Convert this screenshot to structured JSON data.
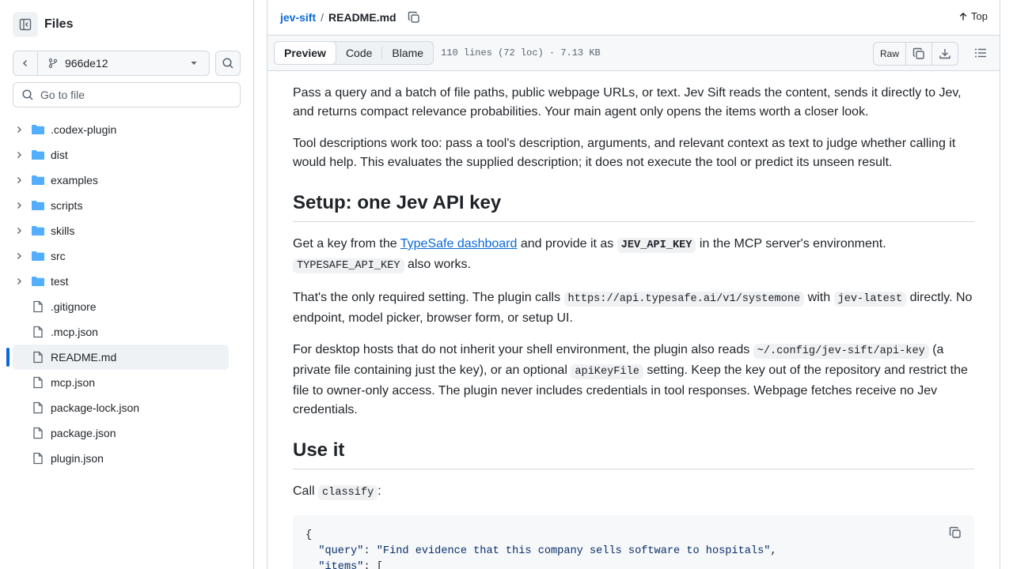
{
  "sidebar": {
    "title": "Files",
    "branch": "966de12",
    "goto_placeholder": "Go to file",
    "folders": [
      ".codex-plugin",
      "dist",
      "examples",
      "scripts",
      "skills",
      "src",
      "test"
    ],
    "files": [
      ".gitignore",
      ".mcp.json",
      "README.md",
      "mcp.json",
      "package-lock.json",
      "package.json",
      "plugin.json"
    ],
    "active_file": "README.md"
  },
  "breadcrumb": {
    "repo": "jev-sift",
    "sep": "/",
    "file": "README.md",
    "top_label": "Top"
  },
  "file_header": {
    "tabs": [
      "Preview",
      "Code",
      "Blame"
    ],
    "meta": "110 lines (72 loc) · 7.13 KB",
    "raw_label": "Raw"
  },
  "content": {
    "p1": "Pass a query and a batch of file paths, public webpage URLs, or text. Jev Sift reads the content, sends it directly to Jev, and returns compact relevance probabilities. Your main agent only opens the items worth a closer look.",
    "p2": "Tool descriptions work too: pass a tool's description, arguments, and relevant context as text to judge whether calling it would help. This evaluates the supplied description; it does not execute the tool or predict its unseen result.",
    "h_setup": "Setup: one Jev API key",
    "p3a": "Get a key from the ",
    "p3_link": "TypeSafe dashboard",
    "p3b": " and provide it as ",
    "p3_code1": "JEV_API_KEY",
    "p3c": " in the MCP server's environment. ",
    "p3_code2": "TYPESAFE_API_KEY",
    "p3d": " also works.",
    "p4a": "That's the only required setting. The plugin calls ",
    "p4_code1": "https://api.typesafe.ai/v1/systemone",
    "p4b": " with ",
    "p4_code2": "jev-latest",
    "p4c": " directly. No endpoint, model picker, browser form, or setup UI.",
    "p5a": "For desktop hosts that do not inherit your shell environment, the plugin also reads ",
    "p5_code1": "~/.config/jev-sift/api-key",
    "p5b": " (a private file containing just the key), or an optional ",
    "p5_code2": "apiKeyFile",
    "p5c": " setting. Keep the key out of the repository and restrict the file to owner-only access. The plugin never includes credentials in tool responses. Webpage fetches receive no Jev credentials.",
    "h_use": "Use it",
    "p6a": "Call ",
    "p6_code": "classify",
    "p6b": ":",
    "code_lines": {
      "l1": "{",
      "l2_key": "\"query\"",
      "l2_val": "\"Find evidence that this company sells software to hospitals\"",
      "l3_key": "\"items\"",
      "l3_rest": ": ["
    }
  },
  "colors": {
    "link": "#0969da",
    "folder": "#54aeff",
    "border": "#d1d9e0"
  }
}
